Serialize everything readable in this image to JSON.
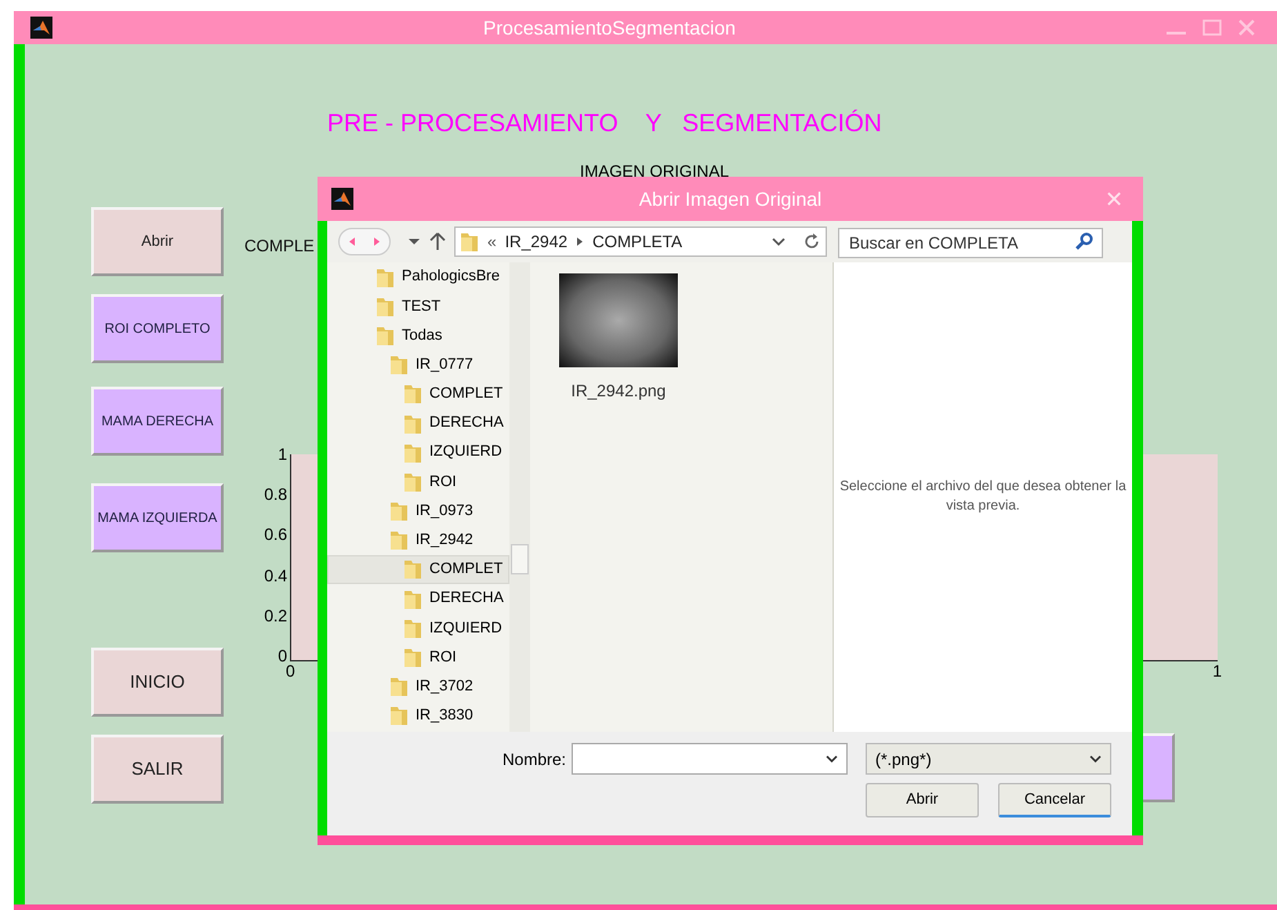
{
  "window": {
    "title": "ProcesamientoSegmentacion"
  },
  "heading": "PRE - PROCESAMIENTO    Y   SEGMENTACIÓN",
  "image_label": "IMAGEN ORIGINAL",
  "side_buttons": [
    {
      "label": "Abrir",
      "kind": "plain"
    },
    {
      "label": "ROI COMPLETO",
      "kind": "tool"
    },
    {
      "label": "MAMA DERECHA",
      "kind": "tool"
    },
    {
      "label": "MAMA IZQUIERDA",
      "kind": "tool"
    },
    {
      "label": "INICIO",
      "kind": "nav"
    },
    {
      "label": "SALIR",
      "kind": "nav"
    }
  ],
  "status_text": "COMPLE",
  "axes": {
    "yticks": [
      "1",
      "0.8",
      "0.6",
      "0.4",
      "0.2",
      "0"
    ],
    "xticks": [
      "0",
      "1"
    ]
  },
  "dialog": {
    "title": "Abrir Imagen Original",
    "address": {
      "overflow_mark": "«",
      "crumbs": [
        "IR_2942",
        "COMPLETA"
      ]
    },
    "search": {
      "placeholder": "Buscar en COMPLETA"
    },
    "tree": [
      {
        "label": "PahologicsBre",
        "selected": false
      },
      {
        "label": "TEST",
        "selected": false
      },
      {
        "label": "Todas",
        "selected": false,
        "children": [
          {
            "label": "IR_0777",
            "selected": false,
            "children": [
              {
                "label": "COMPLET",
                "selected": false
              },
              {
                "label": "DERECHA",
                "selected": false
              },
              {
                "label": "IZQUIERD",
                "selected": false
              },
              {
                "label": "ROI",
                "selected": false
              }
            ]
          },
          {
            "label": "IR_0973",
            "selected": false
          },
          {
            "label": "IR_2942",
            "selected": false,
            "children": [
              {
                "label": "COMPLET",
                "selected": true
              },
              {
                "label": "DERECHA",
                "selected": false
              },
              {
                "label": "IZQUIERD",
                "selected": false
              },
              {
                "label": "ROI",
                "selected": false
              }
            ]
          },
          {
            "label": "IR_3702",
            "selected": false
          },
          {
            "label": "IR_3830",
            "selected": false
          }
        ]
      }
    ],
    "files": [
      {
        "name": "IR_2942.png"
      }
    ],
    "preview_hint": "Seleccione el archivo del que desea obtener la vista previa.",
    "name_label": "Nombre:",
    "filter": "(*.png*)",
    "buttons": [
      {
        "label": "Abrir",
        "focused": false
      },
      {
        "label": "Cancelar",
        "focused": true
      }
    ]
  }
}
